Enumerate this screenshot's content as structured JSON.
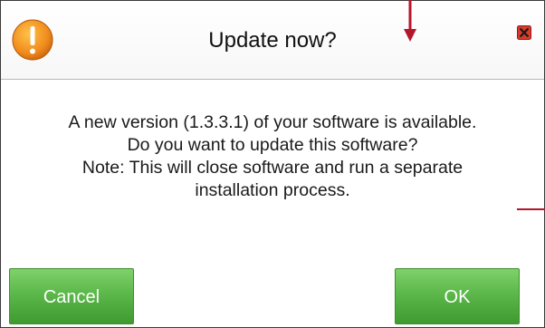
{
  "dialog": {
    "title": "Update now?",
    "message_lines": [
      "A new version (1.3.3.1) of your software is available.",
      "Do you want to update this software?",
      "Note: This will close software and run a separate",
      "installation process."
    ],
    "cancel_label": "Cancel",
    "ok_label": "OK",
    "icons": {
      "warning": "warning-icon",
      "close": "close-icon"
    }
  },
  "colors": {
    "warning_orange": "#f08a1c",
    "close_red": "#d93a2b",
    "button_green": "#5cb84a",
    "annotation_red": "#b5162b"
  }
}
